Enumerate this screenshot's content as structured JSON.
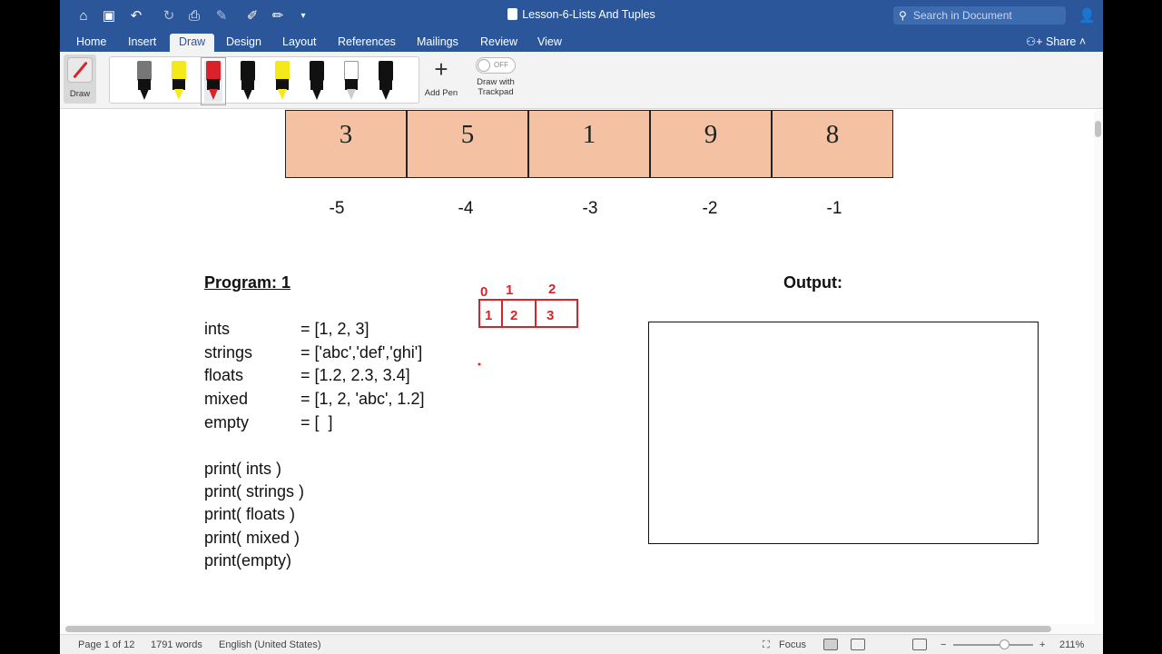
{
  "window": {
    "title": "Lesson-6-Lists And Tuples",
    "search_placeholder": "Search in Document",
    "share_label": "Share"
  },
  "tabs": [
    "Home",
    "Insert",
    "Draw",
    "Design",
    "Layout",
    "References",
    "Mailings",
    "Review",
    "View"
  ],
  "active_tab": "Draw",
  "ribbon": {
    "draw_label": "Draw",
    "add_pen_label": "Add Pen",
    "trackpad_label_1": "Draw with",
    "trackpad_label_2": "Trackpad",
    "toggle_state": "OFF",
    "pens": [
      {
        "name": "pencil-gray",
        "color": "#777777"
      },
      {
        "name": "highlighter-yellow",
        "color": "#f5e91a"
      },
      {
        "name": "pen-red",
        "color": "#d9232a"
      },
      {
        "name": "pen-black",
        "color": "#111111"
      },
      {
        "name": "highlighter-yellow-2",
        "color": "#f5e91a"
      },
      {
        "name": "pen-black-2",
        "color": "#111111"
      },
      {
        "name": "pencil-white",
        "color": "#ffffff"
      },
      {
        "name": "pen-black-3",
        "color": "#111111"
      }
    ]
  },
  "document": {
    "array_values": [
      "3",
      "5",
      "1",
      "9",
      "8"
    ],
    "negative_indices": [
      "-5",
      "-4",
      "-3",
      "-2",
      "-1"
    ],
    "cell_color": "#f4c2a3",
    "program_title": "Program: 1",
    "assignments": [
      {
        "name": "ints",
        "value": "= [1, 2, 3]"
      },
      {
        "name": "strings",
        "value": "= ['abc','def','ghi']"
      },
      {
        "name": "floats",
        "value": "= [1.2, 2.3, 3.4]"
      },
      {
        "name": "mixed",
        "value": "= [1, 2, 'abc', 1.2]"
      },
      {
        "name": "empty",
        "value": "= [  ]"
      }
    ],
    "prints": [
      "print( ints )",
      "print( strings )",
      "print( floats )",
      "print( mixed )",
      "print(empty)"
    ],
    "output_title": "Output:",
    "sketch": {
      "indices": [
        "0",
        "1",
        "2"
      ],
      "values": [
        "1",
        "2",
        "3"
      ],
      "ink_color": "#d9232a"
    }
  },
  "status": {
    "page": "Page 1 of 12",
    "words": "1791 words",
    "language": "English (United States)",
    "focus": "Focus",
    "zoom": "211%"
  }
}
